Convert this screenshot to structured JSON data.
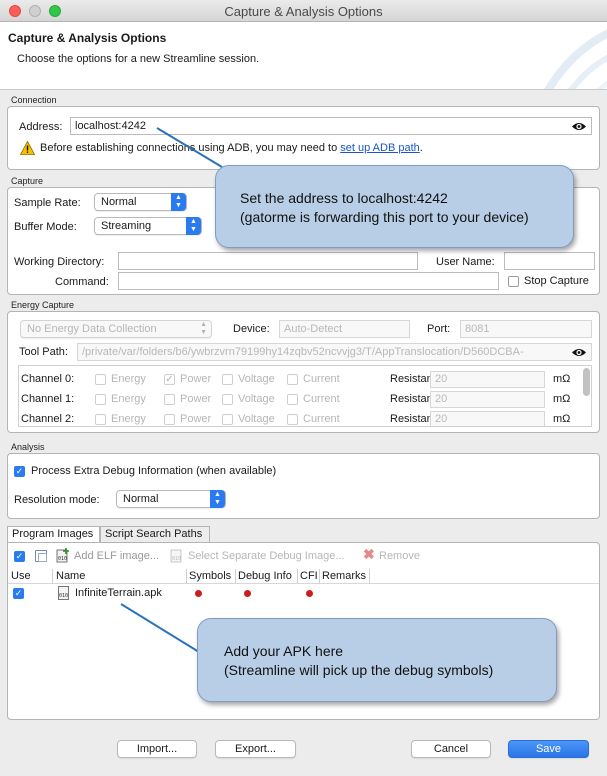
{
  "window": {
    "title": "Capture & Analysis Options"
  },
  "header": {
    "title": "Capture & Analysis Options",
    "description": "Choose the options for a new Streamline session."
  },
  "connection": {
    "section_label": "Connection",
    "address_label": "Address:",
    "address_value": "localhost:4242",
    "warning_text": "Before establishing connections using ADB, you may need to ",
    "warning_link": "set up ADB path",
    "warning_suffix": "."
  },
  "capture": {
    "section_label": "Capture",
    "sample_rate_label": "Sample Rate:",
    "sample_rate_value": "Normal",
    "buffer_mode_label": "Buffer Mode:",
    "buffer_mode_value": "Streaming",
    "working_dir_label": "Working Directory:",
    "working_dir_value": "",
    "user_name_label": "User Name:",
    "user_name_value": "",
    "command_label": "Command:",
    "command_value": "",
    "stop_capture_label": "Stop Capture"
  },
  "energy": {
    "section_label": "Energy Capture",
    "collection_value": "No Energy Data Collection",
    "device_label": "Device:",
    "device_value": "Auto-Detect",
    "port_label": "Port:",
    "port_value": "8081",
    "tool_path_label": "Tool Path:",
    "tool_path_value": "/private/var/folders/b6/ywbrzvrn79199hy14zqbv52ncvvjg3/T/AppTranslocation/D560DCBA-",
    "channel_options": [
      "Energy",
      "Power",
      "Voltage",
      "Current"
    ],
    "resistance_label": "Resistance:",
    "unit": "mΩ",
    "channels": [
      {
        "label": "Channel 0:",
        "resistance": "20",
        "checked": [
          false,
          true,
          false,
          false
        ]
      },
      {
        "label": "Channel 1:",
        "resistance": "20",
        "checked": [
          false,
          false,
          false,
          false
        ]
      },
      {
        "label": "Channel 2:",
        "resistance": "20",
        "checked": [
          false,
          false,
          false,
          false
        ]
      }
    ]
  },
  "analysis": {
    "section_label": "Analysis",
    "process_debug_label": "Process Extra Debug Information (when available)",
    "resolution_label": "Resolution mode:",
    "resolution_value": "Normal"
  },
  "images": {
    "tabs": [
      "Program Images",
      "Script Search Paths"
    ],
    "toolbar": {
      "add_elf": "Add ELF image...",
      "select_debug": "Select Separate Debug Image...",
      "remove": "Remove"
    },
    "columns": [
      "Use",
      "Name",
      "Symbols",
      "Debug Info",
      "CFI",
      "Remarks"
    ],
    "rows": [
      {
        "name": "InfiniteTerrain.apk",
        "use": true
      }
    ]
  },
  "footer": {
    "import": "Import...",
    "export": "Export...",
    "cancel": "Cancel",
    "save": "Save"
  },
  "callouts": {
    "address_line1": "Set the address to localhost:4242",
    "address_line2": "(gatorme is forwarding this port to your device)",
    "apk_line1": "Add your APK here",
    "apk_line2": "(Streamline will pick up the debug symbols)"
  },
  "colors": {
    "accent": "#2a7bf2",
    "callout_fill": "#b8cee6",
    "status_dot": "#c81e1e"
  }
}
